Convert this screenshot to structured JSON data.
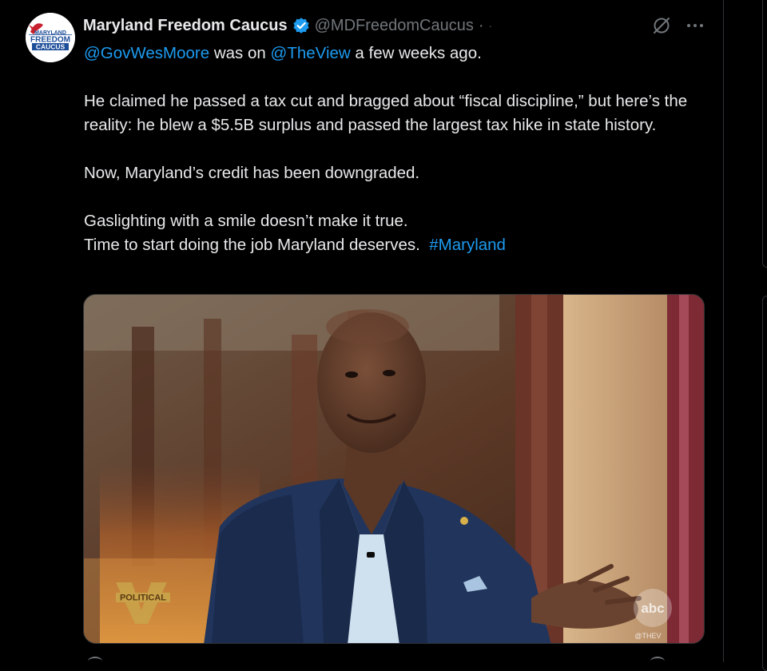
{
  "tweet": {
    "author": {
      "display_name": "Maryland Freedom Caucus",
      "handle": "@MDFreedomCaucus",
      "separator": "·",
      "timestamp": "·",
      "avatar_text": [
        "MARYLAND",
        "FREEDOM",
        "CAUCUS"
      ]
    },
    "body": {
      "line1_mention1": "@GovWesMoore",
      "line1_text1": " was on ",
      "line1_mention2": "@TheView",
      "line1_text2": " a few weeks ago.",
      "para2": "He claimed he passed a tax cut and bragged about “fiscal discipline,” but here’s the reality: he blew a $5.5B surplus and passed the largest tax hike in state history.",
      "para3": "Now, Maryland’s credit has been downgraded.",
      "para4_line1": "Gaslighting with a smile doesn’t make it true.",
      "para4_line2": "Time to start doing the job Maryland deserves.  ",
      "hashtag": "#Maryland"
    },
    "media": {
      "chyron_text": "POLITICAL",
      "chyron_letter": "V",
      "network_logo": "abc",
      "watermark": "@THEV"
    }
  },
  "colors": {
    "background": "#000000",
    "text": "#e7e9ea",
    "secondary_text": "#71767b",
    "link": "#1d9bf0",
    "verified": "#1d9bf0",
    "avatar_red": "#c8202f",
    "avatar_blue": "#1d4e9a"
  },
  "icons": {
    "verified": "verified-badge-icon",
    "grok": "grok-icon",
    "more": "more-icon"
  }
}
